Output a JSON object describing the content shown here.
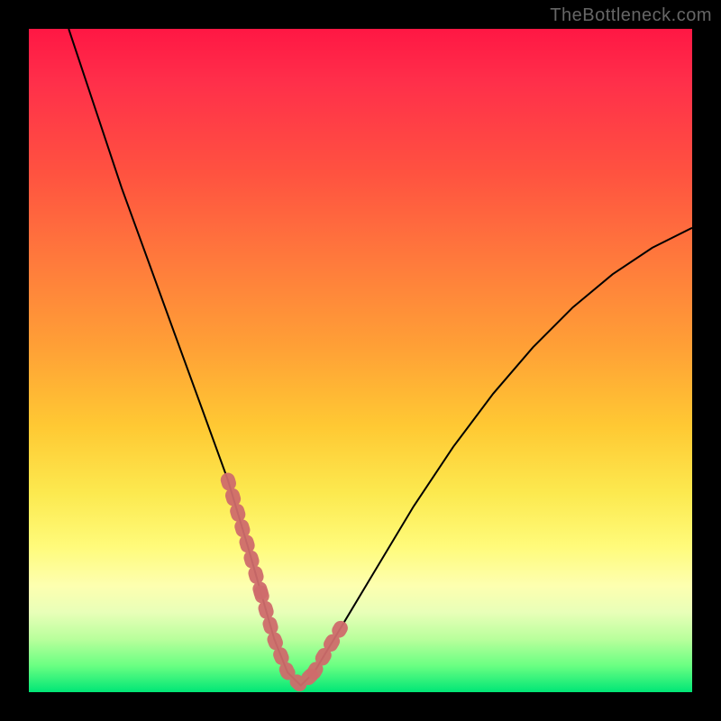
{
  "watermark": "TheBottleneck.com",
  "chart_data": {
    "type": "line",
    "title": "",
    "xlabel": "",
    "ylabel": "",
    "xlim": [
      0,
      100
    ],
    "ylim": [
      0,
      100
    ],
    "series": [
      {
        "name": "bottleneck-curve",
        "x": [
          6,
          10,
          14,
          18,
          22,
          26,
          30,
          33,
          35,
          37,
          39,
          41,
          43,
          46,
          52,
          58,
          64,
          70,
          76,
          82,
          88,
          94,
          100
        ],
        "values": [
          100,
          88,
          76,
          65,
          54,
          43,
          32,
          22,
          15,
          8,
          3,
          1,
          3,
          8,
          18,
          28,
          37,
          45,
          52,
          58,
          63,
          67,
          70
        ]
      }
    ],
    "highlight_segments": [
      {
        "name": "left-highlight",
        "x_start": 30,
        "x_end": 35
      },
      {
        "name": "trough-highlight",
        "x_start": 35,
        "x_end": 43
      },
      {
        "name": "right-highlight",
        "x_start": 43,
        "x_end": 47
      }
    ],
    "colors": {
      "curve": "#000000",
      "highlight": "#cf6b6b",
      "gradient_top": "#ff1744",
      "gradient_mid": "#ffeb3b",
      "gradient_bottom": "#00e676",
      "frame": "#000000"
    }
  }
}
